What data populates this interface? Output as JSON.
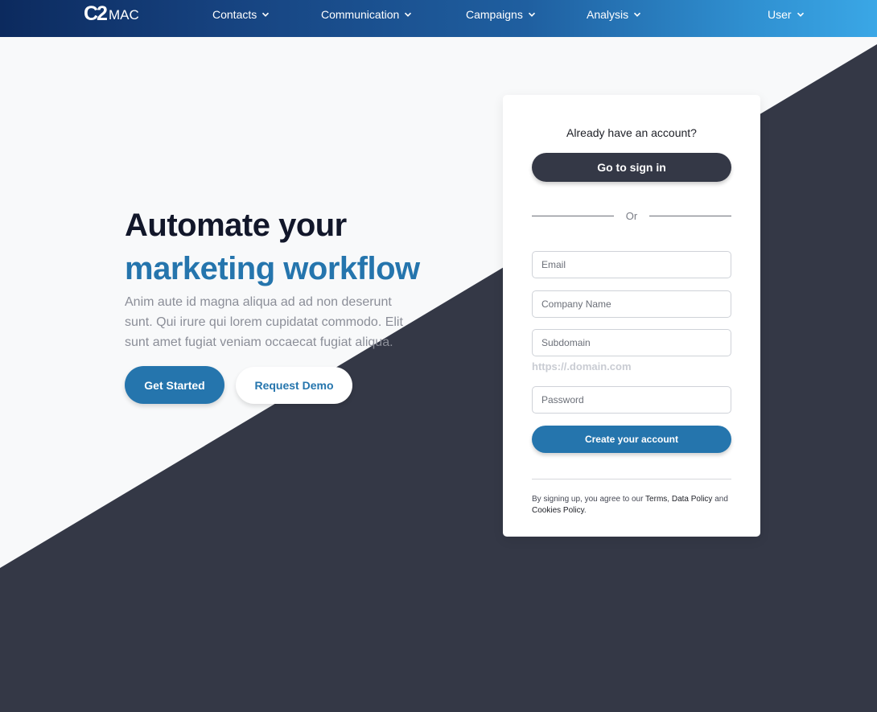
{
  "nav": {
    "logo_mark": "C2",
    "logo_text": "MAC",
    "items": [
      {
        "label": "Contacts"
      },
      {
        "label": "Communication"
      },
      {
        "label": "Campaigns"
      },
      {
        "label": "Analysis"
      }
    ],
    "user_label": "User"
  },
  "hero": {
    "title_line1": "Automate your",
    "title_line2": "marketing workflow",
    "lead": "Anim aute id magna aliqua ad ad non deserunt sunt. Qui irure qui lorem cupidatat commodo. Elit sunt amet fugiat veniam occaecat fugiat aliqua.",
    "primary_cta": "Get Started",
    "secondary_cta": "Request Demo"
  },
  "signup": {
    "already_text": "Already have an account?",
    "sign_in_label": "Go to sign in",
    "or_text": "Or",
    "email_placeholder": "Email",
    "company_placeholder": "Company Name",
    "subdomain_placeholder": "Subdomain",
    "subdomain_hint": "https://.domain.com",
    "password_placeholder": "Password",
    "create_label": "Create your account",
    "terms_prefix": "By signing up, you agree to our",
    "terms_link": "Terms",
    "data_policy_link": "Data Policy",
    "and_text": "and",
    "cookies_link": "Cookies Policy"
  },
  "colors": {
    "accent": "#2575ad",
    "dark": "#343846",
    "background_light": "#f8f9fa"
  }
}
